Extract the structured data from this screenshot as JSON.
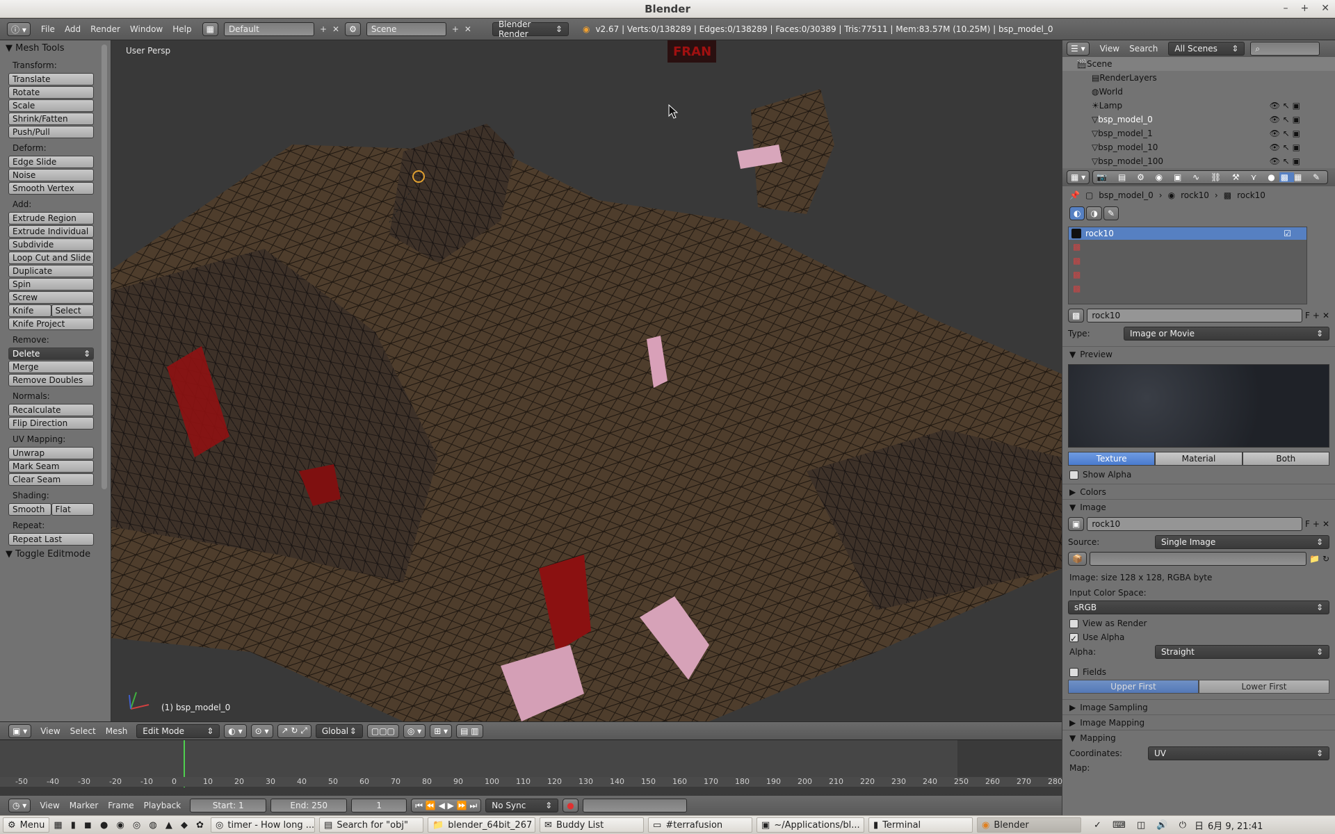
{
  "window": {
    "title": "Blender"
  },
  "info_bar": {
    "menus": [
      "File",
      "Add",
      "Render",
      "Window",
      "Help"
    ],
    "layout": "Default",
    "scene": "Scene",
    "engine": "Blender Render",
    "stats": "v2.67 | Verts:0/138289 | Edges:0/138289 | Faces:0/30389 | Tris:77511 | Mem:83.57M (10.25M) | bsp_model_0"
  },
  "toolshelf": {
    "title": "Mesh Tools",
    "sections": [
      {
        "label": "Transform:",
        "buttons": [
          "Translate",
          "Rotate",
          "Scale",
          "Shrink/Fatten",
          "Push/Pull"
        ]
      },
      {
        "label": "Deform:",
        "buttons": [
          "Edge Slide",
          "Noise",
          "Smooth Vertex"
        ]
      },
      {
        "label": "Add:",
        "buttons": [
          "Extrude Region",
          "Extrude Individual",
          "Subdivide",
          "Loop Cut and Slide",
          "Duplicate",
          "Spin",
          "Screw"
        ]
      }
    ],
    "knife": "Knife",
    "select": "Select",
    "knife_project": "Knife Project",
    "remove_label": "Remove:",
    "delete": "Delete",
    "merge": "Merge",
    "remove_doubles": "Remove Doubles",
    "normals_label": "Normals:",
    "recalculate": "Recalculate",
    "flip_direction": "Flip Direction",
    "uv_label": "UV Mapping:",
    "unwrap": "Unwrap",
    "mark_seam": "Mark Seam",
    "clear_seam": "Clear Seam",
    "shading_label": "Shading:",
    "smooth": "Smooth",
    "flat": "Flat",
    "repeat_label": "Repeat:",
    "repeat_last": "Repeat Last",
    "toggle_editmode": "Toggle Editmode"
  },
  "viewport": {
    "view_name": "User Persp",
    "object_label": "(1) bsp_model_0"
  },
  "view3d_header": {
    "menus": [
      "View",
      "Select",
      "Mesh"
    ],
    "mode": "Edit Mode",
    "orientation": "Global"
  },
  "timeline": {
    "ticks": [
      "-50",
      "-40",
      "-30",
      "-20",
      "-10",
      "0",
      "10",
      "20",
      "30",
      "40",
      "50",
      "60",
      "70",
      "80",
      "90",
      "100",
      "110",
      "120",
      "130",
      "140",
      "150",
      "160",
      "170",
      "180",
      "190",
      "200",
      "210",
      "220",
      "230",
      "240",
      "250",
      "260",
      "270",
      "280"
    ],
    "menus": [
      "View",
      "Marker",
      "Frame",
      "Playback"
    ],
    "start": "Start: 1",
    "end": "End: 250",
    "current": "1",
    "sync": "No Sync"
  },
  "outliner": {
    "menus": [
      "View",
      "Search"
    ],
    "filter": "All Scenes",
    "items": [
      "Scene",
      "RenderLayers",
      "World",
      "Lamp",
      "bsp_model_0",
      "bsp_model_1",
      "bsp_model_10",
      "bsp_model_100"
    ]
  },
  "properties": {
    "breadcrumb": [
      "bsp_model_0",
      "rock10",
      "rock10"
    ],
    "texture_slot": "rock10",
    "texture_name": "rock10",
    "f_label": "F",
    "type_label": "Type:",
    "type_value": "Image or Movie",
    "preview_label": "Preview",
    "preview_tabs": [
      "Texture",
      "Material",
      "Both"
    ],
    "show_alpha": "Show Alpha",
    "colors_label": "Colors",
    "image_label": "Image",
    "image_name": "rock10",
    "source_label": "Source:",
    "source_value": "Single Image",
    "image_info": "Image: size 128 x 128, RGBA byte",
    "input_color_space": "Input Color Space:",
    "color_space": "sRGB",
    "view_as_render": "View as Render",
    "use_alpha": "Use Alpha",
    "alpha_label": "Alpha:",
    "alpha_value": "Straight",
    "fields": "Fields",
    "upper_first": "Upper First",
    "lower_first": "Lower First",
    "image_sampling": "Image Sampling",
    "image_mapping": "Image Mapping",
    "mapping": "Mapping",
    "coordinates_label": "Coordinates:",
    "coordinates_value": "UV",
    "map_label": "Map:"
  },
  "taskbar": {
    "menu": "Menu",
    "tasks": [
      "timer - How long ...",
      "Search for \"obj\"",
      "blender_64bit_267",
      "Buddy List",
      "#terrafusion",
      "~/Applications/bl...",
      "Terminal",
      "Blender"
    ],
    "clock": "6月 9, 21:41",
    "day": "日"
  },
  "colors": {
    "accent": "#5680c2",
    "panel": "#727272",
    "viewport": "#393939"
  }
}
